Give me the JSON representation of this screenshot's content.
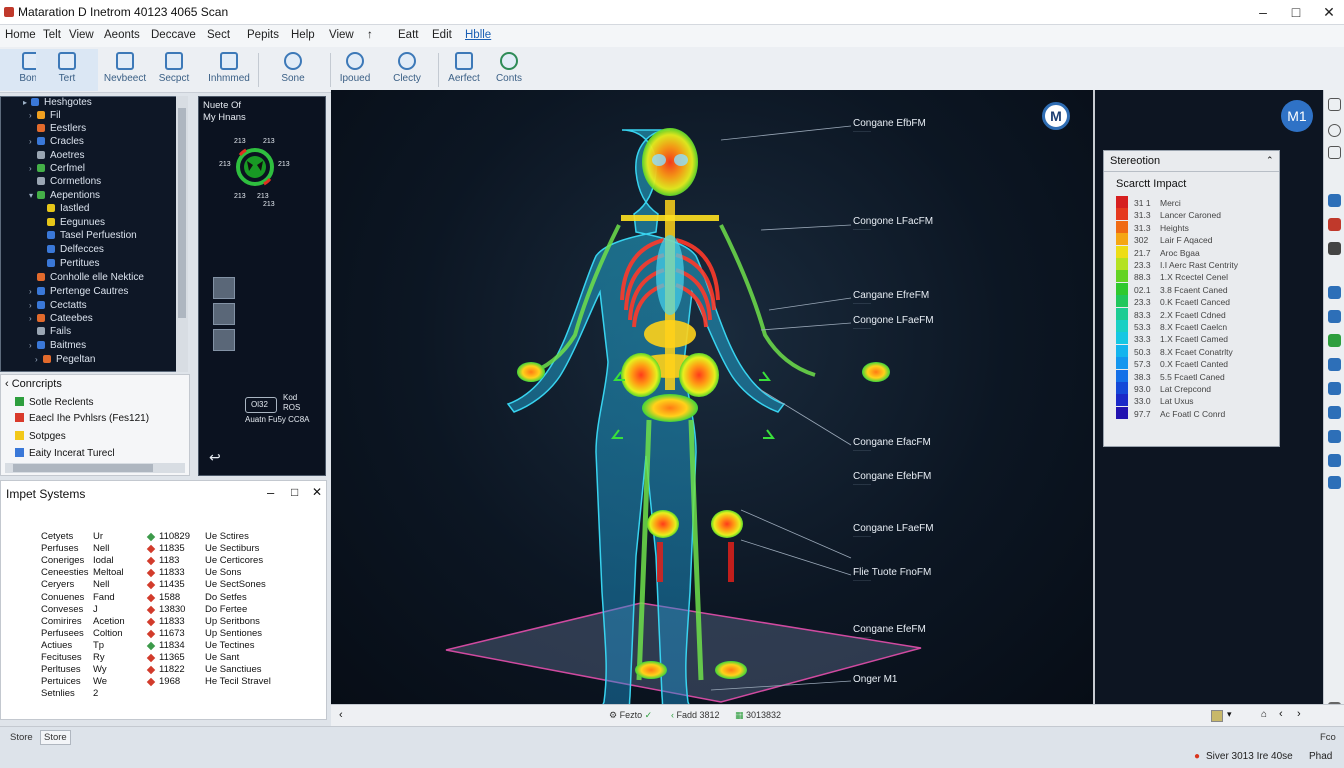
{
  "window": {
    "title": "Mataration D Inetrom 40123 4065 Scan"
  },
  "menu": [
    "Home",
    "Telt",
    "View",
    "Aeonts",
    "Deccave",
    "Sect",
    "Pepits",
    "Help",
    "View",
    "↑",
    "Eatt",
    "Edit",
    "Hblle"
  ],
  "toolbar": [
    {
      "label": "Bone"
    },
    {
      "label": "Tert"
    },
    {
      "label": "Nevbeect"
    },
    {
      "label": "Secpct"
    },
    {
      "label": "Inhmmed"
    },
    {
      "label": "Sone"
    },
    {
      "label": "Ipoued"
    },
    {
      "label": "Clecty"
    },
    {
      "label": "Aerfect"
    },
    {
      "label": "Conts"
    }
  ],
  "nav_tree": [
    {
      "label": "Heshgotes",
      "color": "#3a78d8"
    },
    {
      "label": "Fil",
      "color": "#f0a020"
    },
    {
      "label": "Eestlers",
      "color": "#e26a2c"
    },
    {
      "label": "Cracles",
      "color": "#3a78d8"
    },
    {
      "label": "Aoetres",
      "color": "#9aa6b3"
    },
    {
      "label": "Cerfmel",
      "color": "#44b048"
    },
    {
      "label": "Cormetlons",
      "color": "#9aa6b3"
    },
    {
      "label": "Aepentions",
      "color": "#44b048"
    },
    {
      "label": "Iastled",
      "color": "#e6c619"
    },
    {
      "label": "Eegunues",
      "color": "#e6c619"
    },
    {
      "label": "Tasel Perfuestion",
      "color": "#3a78d8"
    },
    {
      "label": "Delfecces",
      "color": "#3a78d8"
    },
    {
      "label": "Pertitues",
      "color": "#3a78d8"
    },
    {
      "label": "Conholle elle Nektice",
      "color": "#e26a2c"
    },
    {
      "label": "Pertenge Cautres",
      "color": "#3a78d8"
    },
    {
      "label": "Cectatts",
      "color": "#3a78d8"
    },
    {
      "label": "Cateebes",
      "color": "#e26a2c"
    },
    {
      "label": "Fails",
      "color": "#9aa6b3"
    },
    {
      "label": "Baitmes",
      "color": "#3a78d8"
    },
    {
      "label": "Pegeltan",
      "color": "#e26a2c"
    }
  ],
  "concepts": {
    "title": "Conrcripts",
    "items": [
      {
        "label": "Sotle Reclents",
        "color": "#2e9e3e"
      },
      {
        "label": "Eaecl Ihe Pvhlsrs (Fes121)",
        "color": "#d93a2b"
      },
      {
        "label": "Sotpges",
        "color": "#f2c81a"
      },
      {
        "label": "Eaity Incerat Turecl",
        "color": "#3a78d8"
      }
    ]
  },
  "mini": {
    "title_line1": "Nuete Of",
    "title_line2": "My Hnans",
    "nums": [
      "213",
      "213",
      "213",
      "213",
      "213",
      "213",
      "213"
    ],
    "box_label": "Ol32",
    "box_side": "Kod",
    "box_sub": "ROS",
    "caption": "Auatn Fu5y CC8A"
  },
  "impact": {
    "title": "Impet Systems",
    "rows": [
      {
        "a": "Cetyets",
        "b": "Ur",
        "v": "110829",
        "c": "#3c9a4a",
        "d": "Ue Sctires"
      },
      {
        "a": "Perfuses",
        "b": "Nell",
        "v": "11835",
        "c": "#d23b2b",
        "d": "Ue Sectiburs"
      },
      {
        "a": "Coneriges",
        "b": "Iodal",
        "v": "1183",
        "c": "#d23b2b",
        "d": "Ue Certicores"
      },
      {
        "a": "Ceneesties",
        "b": "Meltoal",
        "v": "11833",
        "c": "#d23b2b",
        "d": "Ue Sons"
      },
      {
        "a": "Ceryers",
        "b": "Nell",
        "v": "11435",
        "c": "#d23b2b",
        "d": "Ue SectSones"
      },
      {
        "a": "Conuenes",
        "b": "Fand",
        "v": "1588",
        "c": "#d23b2b",
        "d": "Do Setfes"
      },
      {
        "a": "Conveses",
        "b": "J",
        "v": "13830",
        "c": "#d23b2b",
        "d": "Do Fertee"
      },
      {
        "a": "Comirires",
        "b": "Acetion",
        "v": "11833",
        "c": "#d23b2b",
        "d": "Up Seritbons"
      },
      {
        "a": "Perfusees",
        "b": "Coltion",
        "v": "11673",
        "c": "#d23b2b",
        "d": "Up Sentiones"
      },
      {
        "a": "Actiues",
        "b": "Tp",
        "v": "11834",
        "c": "#3c9a4a",
        "d": "Ue Tectines"
      },
      {
        "a": "Fecituses",
        "b": "Ry",
        "v": "11365",
        "c": "#d23b2b",
        "d": "Ue Sant"
      },
      {
        "a": "Perltuses",
        "b": "Wy",
        "v": "11822",
        "c": "#d23b2b",
        "d": "Ue Sanctiues"
      },
      {
        "a": "Pertuices",
        "b": "We",
        "v": "1968",
        "c": "#d23b2b",
        "d": "He Tecil Stravel"
      },
      {
        "a": "Setnlies",
        "b": "2",
        "v": "",
        "c": "",
        "d": ""
      }
    ]
  },
  "callouts": [
    {
      "label": "Congane EfbFM"
    },
    {
      "label": "Congone LFacFM"
    },
    {
      "label": "Cangane EfreFM"
    },
    {
      "label": "Congone LFaeFM"
    },
    {
      "label": "Congane EfacFM"
    },
    {
      "label": "Congane EfebFM"
    },
    {
      "label": "Congane LFaeFM"
    },
    {
      "label": "Flie Tuote FnoFM"
    },
    {
      "label": "Congane EfeFM"
    },
    {
      "label": "Onger M1"
    }
  ],
  "badges": {
    "viewport": "M",
    "right": "M1"
  },
  "legend": {
    "title": "Stereotion",
    "subtitle": "Scarctt Impact",
    "rows": [
      {
        "v": "31 1",
        "t": "Merci",
        "c": "#d61f1f"
      },
      {
        "v": "31.3",
        "t": "Lancer Caroned",
        "c": "#e5391e"
      },
      {
        "v": "31.3",
        "t": "Heights",
        "c": "#f06a13"
      },
      {
        "v": "302",
        "t": "Lair F Aqaced",
        "c": "#f5a613"
      },
      {
        "v": "21.7",
        "t": "Aroc Bgaa",
        "c": "#eddd16"
      },
      {
        "v": "23.3",
        "t": "I.I Aerc Rast Centrity",
        "c": "#b4e222"
      },
      {
        "v": "88.3",
        "t": "1.X Rcectel Cenel",
        "c": "#63d323"
      },
      {
        "v": "02.1",
        "t": "3.8 Fcaent Caned",
        "c": "#2fc92e"
      },
      {
        "v": "23.3",
        "t": "0.K Fcaetl Canced",
        "c": "#21c75d"
      },
      {
        "v": "83.3",
        "t": "2.X Fcaetl Cdned",
        "c": "#1ccc93"
      },
      {
        "v": "53.3",
        "t": "8.X Fcaetl Caelcn",
        "c": "#19d0c4"
      },
      {
        "v": "33.3",
        "t": "1.X Fcaetl Camed",
        "c": "#16c7e3"
      },
      {
        "v": "50.3",
        "t": "8.X Fcaet Conatrlty",
        "c": "#14b4ee"
      },
      {
        "v": "57.3",
        "t": "0.X Fcaetl Canted",
        "c": "#1496ef"
      },
      {
        "v": "38.3",
        "t": "5.5 Fcaetl Caned",
        "c": "#1470e8"
      },
      {
        "v": "93.0",
        "t": "Lat Crepcond",
        "c": "#1448d8"
      },
      {
        "v": "33.0",
        "t": "Lat Uxus",
        "c": "#1a28c8"
      },
      {
        "v": "97.7",
        "t": "Ac Foatl C Conrd",
        "c": "#2212b0"
      }
    ]
  },
  "viewport_status": {
    "left": "Fezto",
    "mid": "Fadd 3812",
    "right": "3013832"
  },
  "app_status": {
    "store": "Store",
    "store_box": "Store",
    "right_text": "Siver 3013 Ire 40se",
    "right_end": "Phad",
    "top_right": "Fco"
  }
}
